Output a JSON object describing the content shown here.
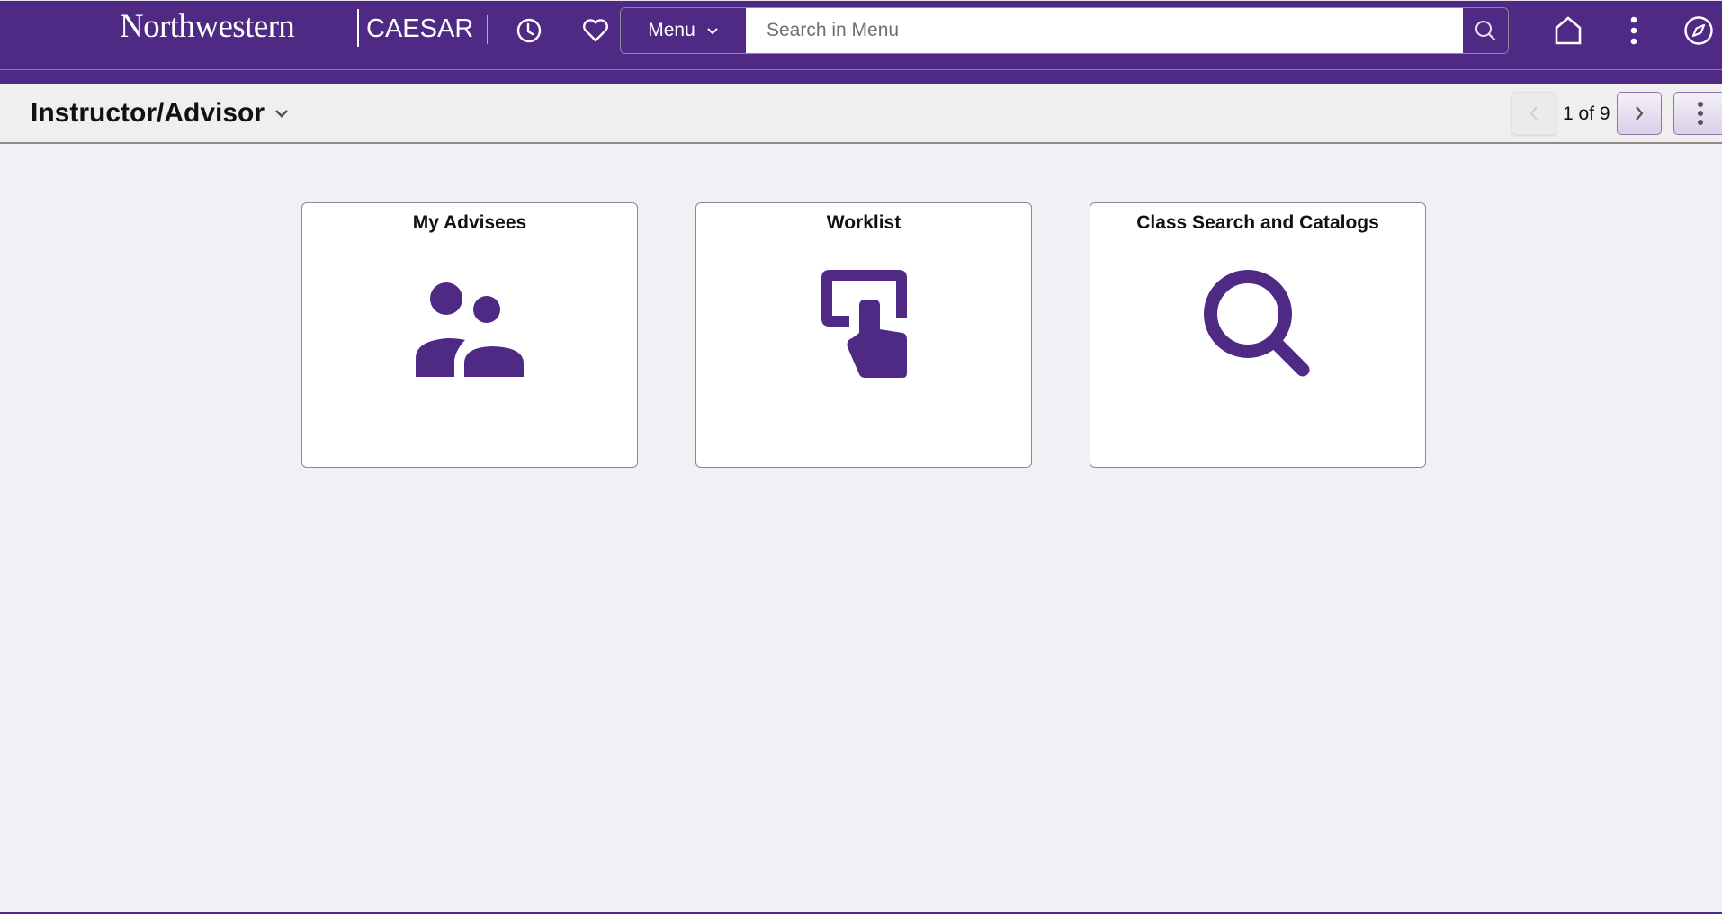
{
  "header": {
    "logo_text": "Northwestern",
    "app_name": "CAESAR",
    "icons": {
      "recent": "clock-icon",
      "favorites": "heart-icon",
      "home": "home-icon",
      "actions": "more-vertical-icon",
      "navigator": "compass-icon"
    },
    "menu_label": "Menu",
    "search_placeholder": "Search in Menu",
    "search_value": ""
  },
  "page": {
    "title": "Instructor/Advisor",
    "pagination": {
      "current": 1,
      "total": 9,
      "label": "1 of 9"
    }
  },
  "tiles": [
    {
      "title": "My Advisees",
      "icon": "advisees-icon"
    },
    {
      "title": "Worklist",
      "icon": "worklist-icon"
    },
    {
      "title": "Class Search and Catalogs",
      "icon": "search-icon"
    }
  ],
  "colors": {
    "brand": "#4e2a84",
    "background": "#eff1f5",
    "pagebar": "#f0efee"
  }
}
